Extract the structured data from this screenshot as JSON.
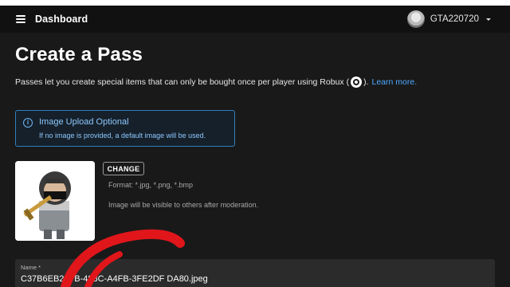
{
  "topbar": {
    "title": "Dashboard",
    "username": "GTA220720"
  },
  "page": {
    "title": "Create a Pass",
    "description": "Passes let you create special items that can only be bought once per player using Robux (",
    "description_end": ").",
    "learn_more": "Learn more."
  },
  "info_box": {
    "icon": "i",
    "title": "Image Upload Optional",
    "text": "If no image is provided, a default image will be used."
  },
  "image_section": {
    "change_label": "CHANGE",
    "format_text": "Format: *.jpg, *.png, *.bmp",
    "visible_text": "Image will be visible to others after moderation."
  },
  "name_field": {
    "label": "Name *",
    "value": "C37B6EB2-9  B-483C-A4FB-3FE2DF   DA80.jpeg"
  },
  "colors": {
    "background": "#191919",
    "topbar": "#111111",
    "accent_link": "#4ea8ff",
    "info_border": "#2f7fbf",
    "scribble": "#e0161b"
  },
  "icons": [
    "menu-icon",
    "avatar",
    "caret-down-icon",
    "robux-icon",
    "info-icon"
  ]
}
